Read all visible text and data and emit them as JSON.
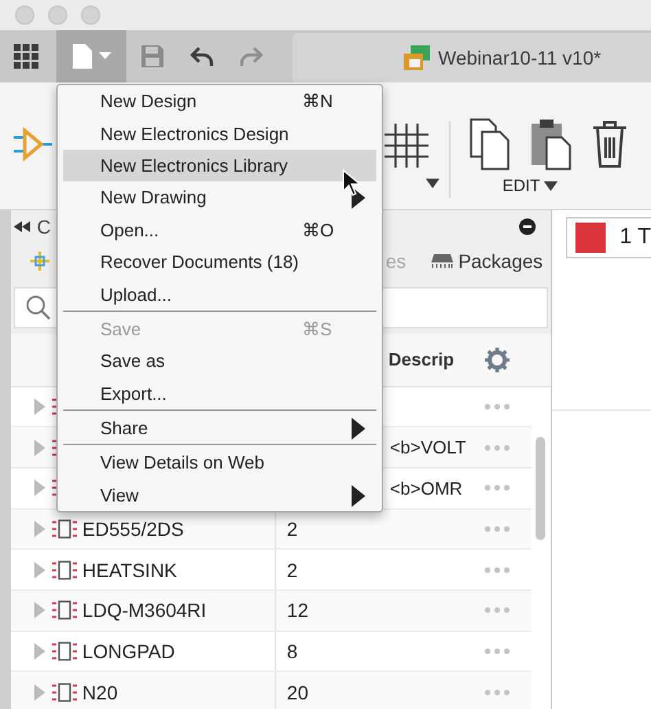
{
  "toolbar": {
    "document_tab": "Webinar10-11 v10*"
  },
  "ribbon": {
    "group_label": "EDIT"
  },
  "panel": {
    "title": "C",
    "tabs": [
      {
        "kind": "sparkle"
      },
      {
        "kind": "plain",
        "label": "es"
      },
      {
        "kind": "chip",
        "label": "Packages"
      }
    ],
    "table": {
      "columns": [
        "Descrip"
      ],
      "rows": [
        {
          "expanded": false
        },
        {
          "description": "<b>VOLT",
          "expanded": false
        },
        {
          "description": "<b>OMR",
          "expanded": false
        },
        {
          "name": "ED555/2DS",
          "count": "2",
          "expanded": false
        },
        {
          "name": "HEATSINK",
          "count": "2",
          "expanded": false
        },
        {
          "name": "LDQ-M3604RI",
          "count": "12",
          "expanded": false
        },
        {
          "name": "LONGPAD",
          "count": "8",
          "expanded": false
        },
        {
          "name": "N20",
          "count": "20",
          "expanded": false
        }
      ]
    }
  },
  "layer": {
    "label": "1 T",
    "color": "#d8343a"
  },
  "file_menu": {
    "items": [
      {
        "kind": "item",
        "label": "New Design",
        "shortcut": "⌘N",
        "selected": false,
        "disabled": false,
        "submenu": false
      },
      {
        "kind": "item",
        "label": "New Electronics Design",
        "selected": false,
        "disabled": false,
        "submenu": false
      },
      {
        "kind": "item",
        "label": "New Electronics Library",
        "selected": true,
        "disabled": false,
        "submenu": false
      },
      {
        "kind": "item",
        "label": "New Drawing",
        "selected": false,
        "disabled": false,
        "submenu": true
      },
      {
        "kind": "item",
        "label": "Open...",
        "shortcut": "⌘O",
        "selected": false,
        "disabled": false,
        "submenu": false
      },
      {
        "kind": "item",
        "label": "Recover Documents (18)",
        "selected": false,
        "disabled": false,
        "submenu": false
      },
      {
        "kind": "item",
        "label": "Upload...",
        "selected": false,
        "disabled": false,
        "submenu": false
      },
      {
        "kind": "separator"
      },
      {
        "kind": "item",
        "label": "Save",
        "shortcut": "⌘S",
        "selected": false,
        "disabled": true,
        "submenu": false
      },
      {
        "kind": "item",
        "label": "Save as",
        "selected": false,
        "disabled": false,
        "submenu": false
      },
      {
        "kind": "item",
        "label": "Export...",
        "selected": false,
        "disabled": false,
        "submenu": false
      },
      {
        "kind": "separator"
      },
      {
        "kind": "item",
        "label": "Share",
        "selected": false,
        "disabled": false,
        "submenu": true
      },
      {
        "kind": "separator"
      },
      {
        "kind": "item",
        "label": "View Details on Web",
        "selected": false,
        "disabled": false,
        "submenu": false
      },
      {
        "kind": "item",
        "label": "View",
        "selected": false,
        "disabled": false,
        "submenu": true
      }
    ]
  }
}
